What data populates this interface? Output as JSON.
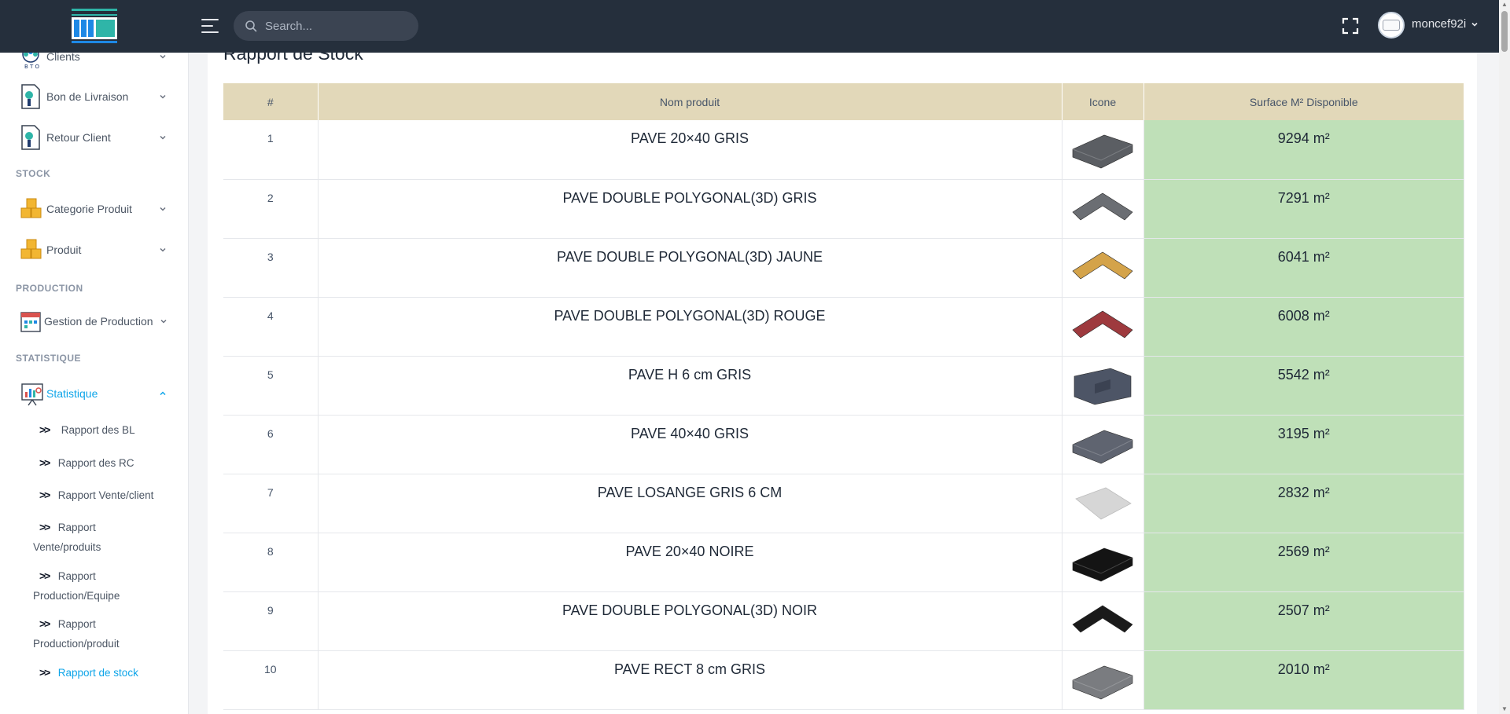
{
  "header": {
    "search_placeholder": "Search...",
    "username": "moncef92i"
  },
  "sidebar": {
    "items": [
      {
        "label": "Clients"
      },
      {
        "label": "Bon de Livraison"
      },
      {
        "label": "Retour Client"
      },
      {
        "label": "Categorie Produit"
      },
      {
        "label": "Produit"
      },
      {
        "label": "Gestion de Production"
      },
      {
        "label": "Statistique"
      }
    ],
    "sections": [
      "STOCK",
      "PRODUCTION",
      "STATISTIQUE"
    ],
    "subitems": [
      {
        "line1": "Rapport des BL",
        "line2": ""
      },
      {
        "line1": "Rapport des RC",
        "line2": ""
      },
      {
        "line1": "Rapport Vente/client",
        "line2": ""
      },
      {
        "line1": "Rapport",
        "line2": "Vente/produits"
      },
      {
        "line1": "Rapport",
        "line2": "Production/Equipe"
      },
      {
        "line1": "Rapport",
        "line2": "Production/produit"
      },
      {
        "line1": "Rapport de stock",
        "line2": ""
      }
    ]
  },
  "main": {
    "title": "Rapport de Stock",
    "columns": [
      "#",
      "Nom produit",
      "Icone",
      "Surface M² Disponible"
    ],
    "rows": [
      {
        "index": "1",
        "name": "PAVE 20×40 GRIS",
        "icon": "paver-rect-gray-icon",
        "color": "#5b5e63",
        "surface": "9294 m²"
      },
      {
        "index": "2",
        "name": "PAVE DOUBLE POLYGONAL(3D) GRIS",
        "icon": "paver-chevron-gray-icon",
        "color": "#6b6e73",
        "surface": "7291 m²"
      },
      {
        "index": "3",
        "name": "PAVE DOUBLE POLYGONAL(3D) JAUNE",
        "icon": "paver-chevron-yellow-icon",
        "color": "#d4a34a",
        "surface": "6041 m²"
      },
      {
        "index": "4",
        "name": "PAVE DOUBLE POLYGONAL(3D) ROUGE",
        "icon": "paver-chevron-red-icon",
        "color": "#9e3a3e",
        "surface": "6008 m²"
      },
      {
        "index": "5",
        "name": "PAVE H 6 cm GRIS",
        "icon": "paver-h-gray-icon",
        "color": "#4d5566",
        "surface": "5542 m²"
      },
      {
        "index": "6",
        "name": "PAVE 40×40 GRIS",
        "icon": "paver-square-gray-icon",
        "color": "#5f6470",
        "surface": "3195 m²"
      },
      {
        "index": "7",
        "name": "PAVE LOSANGE GRIS 6 CM",
        "icon": "paver-diamond-light-icon",
        "color": "#d6d6d6",
        "surface": "2832 m²"
      },
      {
        "index": "8",
        "name": "PAVE 20×40 NOIRE",
        "icon": "paver-rect-black-icon",
        "color": "#141414",
        "surface": "2569 m²"
      },
      {
        "index": "9",
        "name": "PAVE DOUBLE POLYGONAL(3D) NOIR",
        "icon": "paver-chevron-black-icon",
        "color": "#1a1a1a",
        "surface": "2507 m²"
      },
      {
        "index": "10",
        "name": "PAVE RECT 8 cm GRIS",
        "icon": "paver-rect-8cm-gray-icon",
        "color": "#7a7c80",
        "surface": "2010 m²"
      }
    ]
  },
  "colors": {
    "topbar": "#252f3c",
    "header_row": "#e2d8b9",
    "surface_cell": "#bfe0b8",
    "active": "#0ea5e9"
  }
}
